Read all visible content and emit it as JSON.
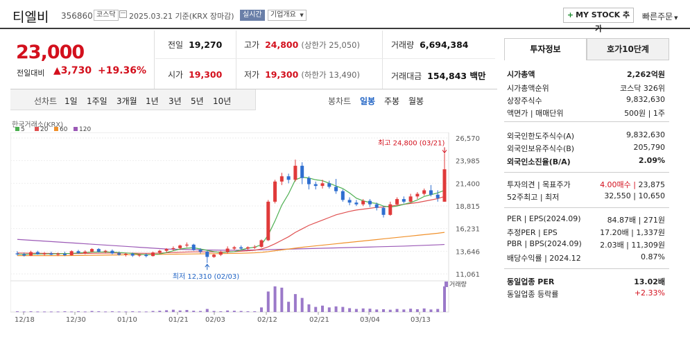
{
  "header": {
    "company_name": "티엘비",
    "code": "356860",
    "market": "코스닥",
    "date_text": "2025.03.21 기준(KRX 장마감)",
    "realtime": "실시간",
    "company_info": "기업개요",
    "mystock": "MY STOCK 추가",
    "quick_order": "빠른주문"
  },
  "price": {
    "current": "23,000",
    "change_label": "전일대비",
    "change": "3,730",
    "change_pct": "+19.36%"
  },
  "stats": {
    "prev_label": "전일",
    "prev": "19,270",
    "open_label": "시가",
    "open": "19,300",
    "high_label": "고가",
    "high": "24,800",
    "upper_limit": "(상한가 25,050)",
    "low_label": "저가",
    "low": "19,300",
    "lower_limit": "(하한가 13,490)",
    "volume_label": "거래량",
    "volume": "6,694,384",
    "amount_label": "거래대금",
    "amount": "154,843 백만"
  },
  "period": {
    "head": "선차트",
    "items": [
      "1일",
      "1주일",
      "3개월",
      "1년",
      "3년",
      "5년",
      "10년"
    ],
    "candle_head": "봉차트",
    "candle_items": [
      "일봉",
      "주봉",
      "월봉"
    ],
    "active_candle": "일봉"
  },
  "chart": {
    "exchange": "한국거래소(KRX)",
    "ma_legend": [
      {
        "label": "5",
        "color": "#4caf50"
      },
      {
        "label": "20",
        "color": "#e05050"
      },
      {
        "label": "60",
        "color": "#f0902a"
      },
      {
        "label": "120",
        "color": "#9b59b6"
      }
    ],
    "y_ticks": [
      "26,570",
      "23,985",
      "21,400",
      "18,815",
      "16,231",
      "13,646",
      "11,061"
    ],
    "x_ticks": [
      "12/18",
      "12/30",
      "01/10",
      "01/21",
      "02/03",
      "02/12",
      "02/21",
      "03/04",
      "03/13"
    ],
    "high_annot": "최고 24,800 (03/21)",
    "low_annot": "최저 12,310 (02/03)",
    "volume_label": "거래량",
    "up_color": "#e03a3a",
    "down_color": "#2f6fd0"
  },
  "chart_data": {
    "type": "candlestick",
    "ylim": [
      11061,
      26570
    ],
    "candles": [
      {
        "o": 13400,
        "h": 13650,
        "l": 13150,
        "c": 13300
      },
      {
        "o": 13300,
        "h": 13500,
        "l": 13050,
        "c": 13150
      },
      {
        "o": 13150,
        "h": 13700,
        "l": 13100,
        "c": 13550
      },
      {
        "o": 13550,
        "h": 13700,
        "l": 13250,
        "c": 13300
      },
      {
        "o": 13300,
        "h": 13550,
        "l": 13150,
        "c": 13400
      },
      {
        "o": 13400,
        "h": 13600,
        "l": 13200,
        "c": 13250
      },
      {
        "o": 13250,
        "h": 13500,
        "l": 13100,
        "c": 13350
      },
      {
        "o": 13350,
        "h": 13600,
        "l": 13100,
        "c": 13200
      },
      {
        "o": 13200,
        "h": 13750,
        "l": 13150,
        "c": 13650
      },
      {
        "o": 13650,
        "h": 13800,
        "l": 13350,
        "c": 13450
      },
      {
        "o": 13450,
        "h": 13750,
        "l": 13300,
        "c": 13600
      },
      {
        "o": 13600,
        "h": 14000,
        "l": 13500,
        "c": 13900
      },
      {
        "o": 13900,
        "h": 14000,
        "l": 13500,
        "c": 13600
      },
      {
        "o": 13600,
        "h": 13800,
        "l": 13400,
        "c": 13700
      },
      {
        "o": 13700,
        "h": 13850,
        "l": 13300,
        "c": 13400
      },
      {
        "o": 13400,
        "h": 13600,
        "l": 13150,
        "c": 13250
      },
      {
        "o": 13250,
        "h": 13450,
        "l": 13050,
        "c": 13350
      },
      {
        "o": 13350,
        "h": 13500,
        "l": 13000,
        "c": 13150
      },
      {
        "o": 13150,
        "h": 13350,
        "l": 13000,
        "c": 13250
      },
      {
        "o": 13250,
        "h": 13400,
        "l": 12950,
        "c": 13100
      },
      {
        "o": 13100,
        "h": 13600,
        "l": 13050,
        "c": 13500
      },
      {
        "o": 13500,
        "h": 13800,
        "l": 13300,
        "c": 13700
      },
      {
        "o": 13700,
        "h": 14000,
        "l": 13500,
        "c": 13900
      },
      {
        "o": 13900,
        "h": 14200,
        "l": 13700,
        "c": 14000
      },
      {
        "o": 14000,
        "h": 14400,
        "l": 13800,
        "c": 14300
      },
      {
        "o": 14300,
        "h": 14650,
        "l": 14100,
        "c": 14400
      },
      {
        "o": 14400,
        "h": 14500,
        "l": 13700,
        "c": 13800
      },
      {
        "o": 13800,
        "h": 14000,
        "l": 13400,
        "c": 13600
      },
      {
        "o": 13600,
        "h": 13700,
        "l": 12310,
        "c": 13000
      },
      {
        "o": 13000,
        "h": 13350,
        "l": 12900,
        "c": 13250
      },
      {
        "o": 13250,
        "h": 13700,
        "l": 13100,
        "c": 13550
      },
      {
        "o": 13550,
        "h": 14200,
        "l": 13400,
        "c": 13950
      },
      {
        "o": 13950,
        "h": 14250,
        "l": 13750,
        "c": 14100
      },
      {
        "o": 14100,
        "h": 14300,
        "l": 13800,
        "c": 13950
      },
      {
        "o": 13950,
        "h": 14200,
        "l": 13800,
        "c": 14100
      },
      {
        "o": 14100,
        "h": 14350,
        "l": 13900,
        "c": 14150
      },
      {
        "o": 14150,
        "h": 15000,
        "l": 14050,
        "c": 14900
      },
      {
        "o": 14900,
        "h": 19500,
        "l": 14800,
        "c": 19300
      },
      {
        "o": 19300,
        "h": 21800,
        "l": 19100,
        "c": 21600
      },
      {
        "o": 21600,
        "h": 22600,
        "l": 21200,
        "c": 22200
      },
      {
        "o": 22200,
        "h": 22500,
        "l": 21400,
        "c": 21800
      },
      {
        "o": 21800,
        "h": 24100,
        "l": 21600,
        "c": 23400
      },
      {
        "o": 23400,
        "h": 23800,
        "l": 21300,
        "c": 22000
      },
      {
        "o": 22000,
        "h": 22200,
        "l": 20700,
        "c": 21300
      },
      {
        "o": 21300,
        "h": 21600,
        "l": 20700,
        "c": 21100
      },
      {
        "o": 21100,
        "h": 21800,
        "l": 20800,
        "c": 21400
      },
      {
        "o": 21400,
        "h": 21700,
        "l": 20800,
        "c": 21000
      },
      {
        "o": 21000,
        "h": 21900,
        "l": 20200,
        "c": 20500
      },
      {
        "o": 20500,
        "h": 20700,
        "l": 19300,
        "c": 19500
      },
      {
        "o": 19500,
        "h": 19800,
        "l": 18900,
        "c": 19200
      },
      {
        "o": 19200,
        "h": 19500,
        "l": 18800,
        "c": 19000
      },
      {
        "o": 19000,
        "h": 19600,
        "l": 18800,
        "c": 19400
      },
      {
        "o": 19400,
        "h": 19600,
        "l": 18700,
        "c": 19000
      },
      {
        "o": 19000,
        "h": 19200,
        "l": 18300,
        "c": 18600
      },
      {
        "o": 18600,
        "h": 18800,
        "l": 17500,
        "c": 17800
      },
      {
        "o": 17800,
        "h": 19300,
        "l": 17700,
        "c": 19000
      },
      {
        "o": 19000,
        "h": 19800,
        "l": 18900,
        "c": 19600
      },
      {
        "o": 19600,
        "h": 19900,
        "l": 19100,
        "c": 19300
      },
      {
        "o": 19300,
        "h": 20200,
        "l": 19200,
        "c": 19900
      },
      {
        "o": 19900,
        "h": 20400,
        "l": 19600,
        "c": 20200
      },
      {
        "o": 20200,
        "h": 20800,
        "l": 20000,
        "c": 20600
      },
      {
        "o": 20600,
        "h": 21200,
        "l": 19900,
        "c": 20100
      },
      {
        "o": 20100,
        "h": 20600,
        "l": 19300,
        "c": 19700
      },
      {
        "o": 19300,
        "h": 24800,
        "l": 19300,
        "c": 23000
      }
    ],
    "volume": [
      3,
      2,
      3,
      2,
      2,
      2,
      2,
      3,
      2,
      3,
      2,
      4,
      3,
      2,
      3,
      2,
      2,
      3,
      2,
      2,
      4,
      5,
      7,
      9,
      6,
      8,
      5,
      4,
      12,
      4,
      3,
      6,
      5,
      4,
      3,
      3,
      18,
      80,
      100,
      95,
      40,
      70,
      55,
      30,
      20,
      25,
      18,
      22,
      20,
      15,
      12,
      14,
      13,
      10,
      11,
      9,
      12,
      10,
      13,
      11,
      14,
      10,
      12,
      100
    ],
    "ma5": [
      13300,
      13300,
      13320,
      13330,
      13340,
      13350,
      13360,
      13380,
      13400,
      13450,
      13500,
      13550,
      13560,
      13560,
      13550,
      13500,
      13450,
      13400,
      13300,
      13250,
      13260,
      13330,
      13500,
      13700,
      13900,
      14000,
      14050,
      13900,
      13750,
      13600,
      13500,
      13550,
      13600,
      13800,
      14000,
      14100,
      14400,
      15500,
      17100,
      18900,
      20200,
      21800,
      22100,
      22000,
      21800,
      21700,
      21400,
      21100,
      20800,
      20300,
      19700,
      19400,
      19200,
      19100,
      18800,
      18700,
      18800,
      19000,
      19200,
      19500,
      19900,
      20100,
      20300,
      20600
    ],
    "ma20": [
      13450,
      13440,
      13430,
      13420,
      13410,
      13400,
      13390,
      13380,
      13380,
      13390,
      13400,
      13410,
      13420,
      13430,
      13440,
      13440,
      13440,
      13430,
      13420,
      13410,
      13420,
      13440,
      13470,
      13500,
      13530,
      13560,
      13580,
      13580,
      13570,
      13560,
      13560,
      13570,
      13600,
      13650,
      13700,
      13760,
      13900,
      14150,
      14500,
      14900,
      15300,
      15800,
      16200,
      16600,
      16900,
      17200,
      17500,
      17800,
      18000,
      18200,
      18350,
      18450,
      18550,
      18650,
      18700,
      18800,
      18900,
      19000,
      19100,
      19200,
      19350,
      19500,
      19650,
      19900
    ],
    "ma60": [
      13150,
      13150,
      13150,
      13150,
      13150,
      13150,
      13150,
      13150,
      13160,
      13170,
      13180,
      13190,
      13200,
      13210,
      13220,
      13230,
      13240,
      13250,
      13260,
      13270,
      13280,
      13290,
      13300,
      13310,
      13320,
      13330,
      13340,
      13350,
      13360,
      13370,
      13380,
      13390,
      13400,
      13420,
      13440,
      13470,
      13520,
      13600,
      13700,
      13800,
      13900,
      14000,
      14100,
      14180,
      14260,
      14340,
      14420,
      14500,
      14580,
      14660,
      14740,
      14820,
      14900,
      14980,
      15060,
      15140,
      15220,
      15300,
      15380,
      15460,
      15540,
      15620,
      15700,
      15800
    ],
    "ma120": [
      15000,
      14950,
      14900,
      14850,
      14800,
      14750,
      14700,
      14650,
      14600,
      14550,
      14500,
      14450,
      14400,
      14350,
      14300,
      14250,
      14200,
      14150,
      14100,
      14050,
      14000,
      13950,
      13900,
      13880,
      13860,
      13840,
      13820,
      13800,
      13790,
      13780,
      13770,
      13760,
      13760,
      13770,
      13780,
      13790,
      13810,
      13830,
      13850,
      13870,
      13890,
      13910,
      13930,
      13950,
      13970,
      13990,
      14010,
      14030,
      14050,
      14070,
      14090,
      14110,
      14130,
      14150,
      14170,
      14190,
      14210,
      14230,
      14260,
      14290,
      14320,
      14350,
      14380,
      14420
    ]
  },
  "panel": {
    "tabs": [
      "투자정보",
      "호가10단계"
    ],
    "rows": [
      {
        "k": "시가총액",
        "v": "2,262억원",
        "bold": true
      },
      {
        "k": "시가총액순위",
        "v": "코스닥 326위"
      },
      {
        "k": "상장주식수",
        "v": "9,832,630"
      },
      {
        "k": "액면가 | 매매단위",
        "v": "500원 | 1주"
      },
      {
        "k": "외국인한도주식수(A)",
        "v": "9,832,630"
      },
      {
        "k": "외국인보유주식수(B)",
        "v": "205,790"
      },
      {
        "k": "외국인소진율(B/A)",
        "v": "2.09%",
        "bold": true
      },
      {
        "k": "투자의견 | 목표주가",
        "v": "23,875",
        "v_red": "4.00매수 | "
      },
      {
        "k": "52주최고 | 최저",
        "v": "32,550 | 10,650"
      },
      {
        "k": "PER | EPS(2024.09)",
        "v": "84.87배 | 271원"
      },
      {
        "k": "추정PER | EPS",
        "v": "17.20배 | 1,337원"
      },
      {
        "k": "PBR | BPS(2024.09)",
        "v": "2.03배 | 11,309원"
      },
      {
        "k": "배당수익률 | 2024.12",
        "v": "0.87%"
      },
      {
        "k": "동일업종 PER",
        "v": "13.02배",
        "bold": true
      },
      {
        "k": "동일업종 등락률",
        "v": "+2.33%",
        "red": true
      }
    ]
  }
}
